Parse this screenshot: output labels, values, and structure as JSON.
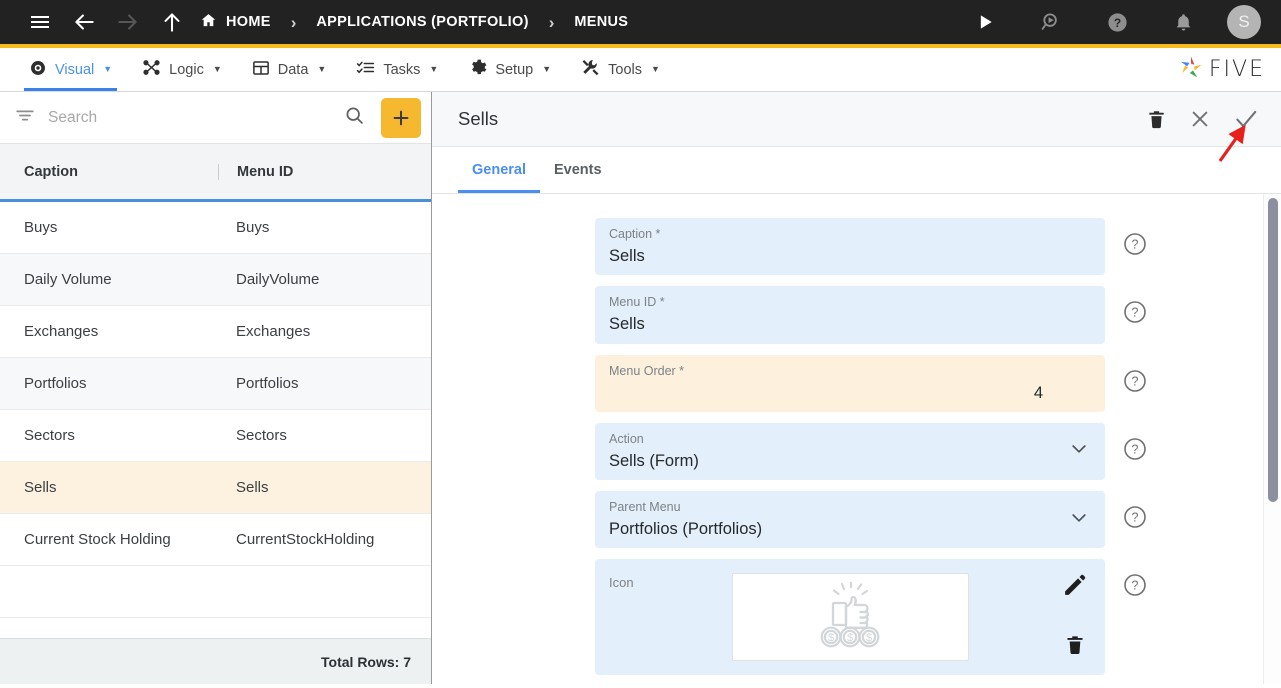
{
  "topbar": {
    "menu_icon": "hamburger-icon",
    "back_icon": "arrow-left-icon",
    "forward_icon": "arrow-right-icon",
    "up_icon": "arrow-up-icon",
    "breadcrumbs": [
      {
        "label": "HOME",
        "icon": "home-icon"
      },
      {
        "label": "APPLICATIONS (PORTFOLIO)",
        "icon": ""
      },
      {
        "label": "MENUS",
        "icon": ""
      }
    ],
    "separator": "›",
    "actions": [
      {
        "name": "run-icon"
      },
      {
        "name": "debug-search-icon"
      },
      {
        "name": "help-circle-icon"
      },
      {
        "name": "notifications-bell-icon"
      }
    ],
    "avatar_initial": "S",
    "accent_color": "#f9ba1f",
    "bar_color": "#222222"
  },
  "modbar": {
    "tabs": [
      {
        "label": "Visual",
        "icon": "eye-icon",
        "active": true
      },
      {
        "label": "Logic",
        "icon": "nodes-icon",
        "active": false
      },
      {
        "label": "Data",
        "icon": "table-icon",
        "active": false
      },
      {
        "label": "Tasks",
        "icon": "checklist-icon",
        "active": false
      },
      {
        "label": "Setup",
        "icon": "gear-icon",
        "active": false
      },
      {
        "label": "Tools",
        "icon": "wrench-icon",
        "active": false
      }
    ],
    "caret": "▼",
    "active_color": "#4a8ff0",
    "logo_text": "FIVE"
  },
  "sidebar": {
    "search": {
      "placeholder": "Search",
      "value": ""
    },
    "filter_icon": "filter-icon",
    "search_icon": "search-icon",
    "add_button_label": "+",
    "add_button_color": "#f5b82e",
    "columns": [
      "Caption",
      "Menu ID"
    ],
    "rows": [
      {
        "caption": "Buys",
        "menu_id": "Buys",
        "selected": false
      },
      {
        "caption": "Daily Volume",
        "menu_id": "DailyVolume",
        "selected": false
      },
      {
        "caption": "Exchanges",
        "menu_id": "Exchanges",
        "selected": false
      },
      {
        "caption": "Portfolios",
        "menu_id": "Portfolios",
        "selected": false
      },
      {
        "caption": "Sectors",
        "menu_id": "Sectors",
        "selected": false
      },
      {
        "caption": "Sells",
        "menu_id": "Sells",
        "selected": true
      },
      {
        "caption": "Current Stock Holding",
        "menu_id": "CurrentStockHolding",
        "selected": false
      }
    ],
    "footer_text": "Total Rows: 7",
    "selected_row_color": "#fdf2df"
  },
  "detail": {
    "title": "Sells",
    "header_actions": [
      {
        "name": "delete-icon"
      },
      {
        "name": "close-icon"
      },
      {
        "name": "confirm-check-icon"
      }
    ],
    "tabs": [
      {
        "label": "General",
        "active": true
      },
      {
        "label": "Events",
        "active": false
      }
    ],
    "fields": [
      {
        "label": "Caption *",
        "value": "Sells",
        "type": "text",
        "tone": "blue",
        "align": "left"
      },
      {
        "label": "Menu ID *",
        "value": "Sells",
        "type": "text",
        "tone": "blue",
        "align": "left"
      },
      {
        "label": "Menu Order *",
        "value": "4",
        "type": "number",
        "tone": "amber",
        "align": "right"
      },
      {
        "label": "Action",
        "value": "Sells (Form)",
        "type": "select",
        "tone": "blue",
        "align": "left"
      },
      {
        "label": "Parent Menu",
        "value": "Portfolios (Portfolios)",
        "type": "select",
        "tone": "blue",
        "align": "left"
      }
    ],
    "icon_field": {
      "label": "Icon",
      "preview_icon": "thumbs-up-with-coins-icon",
      "edit_icon": "pencil-icon",
      "delete_icon": "trash-icon"
    },
    "help_icon": "help-circle-icon",
    "chevron_icon": "chevron-down-icon"
  },
  "annotation": {
    "arrow_color": "#e8201b",
    "points_to": "confirm-check-icon"
  }
}
